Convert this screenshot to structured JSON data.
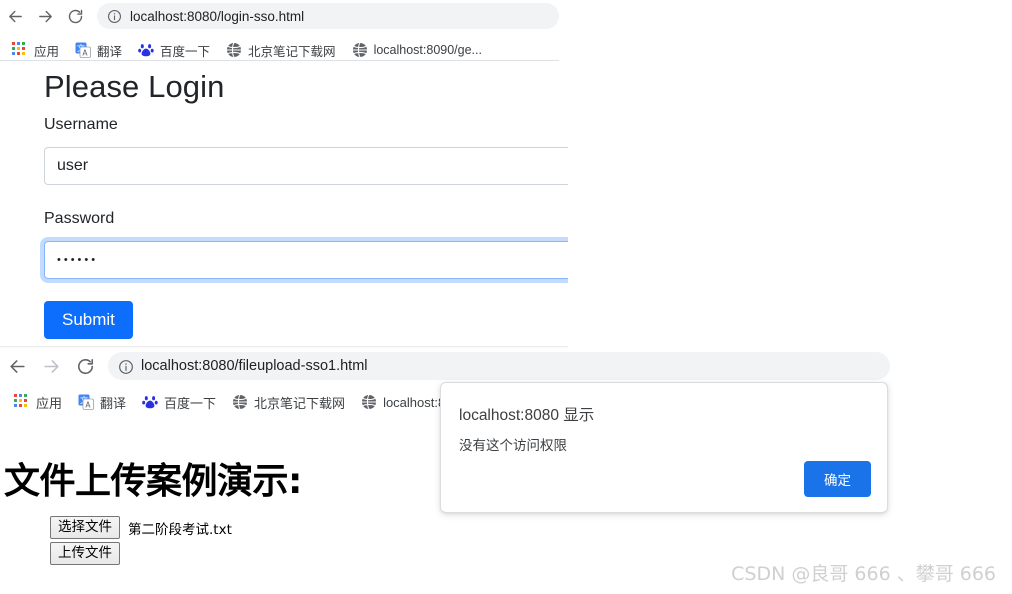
{
  "window1": {
    "nav": {
      "back_label": "Back",
      "forward_label": "Forward",
      "reload_label": "Reload"
    },
    "omnibox": {
      "url": "localhost:8080/login-sso.html",
      "site_info_icon": "info-circle-icon"
    },
    "bookmarks": [
      {
        "label": "应用",
        "icon": "apps-grid-icon"
      },
      {
        "label": "翻译",
        "icon": "google-translate-icon"
      },
      {
        "label": "百度一下",
        "icon": "baidu-paw-icon"
      },
      {
        "label": "北京笔记下载网",
        "icon": "globe-icon"
      },
      {
        "label": "localhost:8090/ge...",
        "icon": "globe-icon"
      }
    ],
    "page": {
      "title": "Please Login",
      "username_label": "Username",
      "username_value": "user",
      "username_placeholder": "",
      "password_label": "Password",
      "password_value": "••••••",
      "password_placeholder": "",
      "submit_label": "Submit",
      "submit_color": "#0d6efd",
      "focus_ring_color": "#86b7fe"
    }
  },
  "window2": {
    "nav": {
      "back_label": "Back",
      "forward_label": "Forward",
      "reload_label": "Reload"
    },
    "omnibox": {
      "url": "localhost:8080/fileupload-sso1.html",
      "site_info_icon": "info-circle-icon"
    },
    "bookmarks": [
      {
        "label": "应用",
        "icon": "apps-grid-icon"
      },
      {
        "label": "翻译",
        "icon": "google-translate-icon"
      },
      {
        "label": "百度一下",
        "icon": "baidu-paw-icon"
      },
      {
        "label": "北京笔记下载网",
        "icon": "globe-icon"
      },
      {
        "label": "localhost:80",
        "icon": "globe-icon"
      }
    ],
    "page": {
      "heading": "文件上传案例演示:",
      "choose_file_label": "选择文件",
      "file_name": "第二阶段考试.txt",
      "upload_label": "上传文件"
    }
  },
  "dialog": {
    "origin": "localhost:8080 显示",
    "message": "没有这个访问权限",
    "ok_label": "确定",
    "ok_color": "#1a73e8"
  },
  "watermark": {
    "text": "CSDN @良哥 666 、攀哥 666"
  }
}
